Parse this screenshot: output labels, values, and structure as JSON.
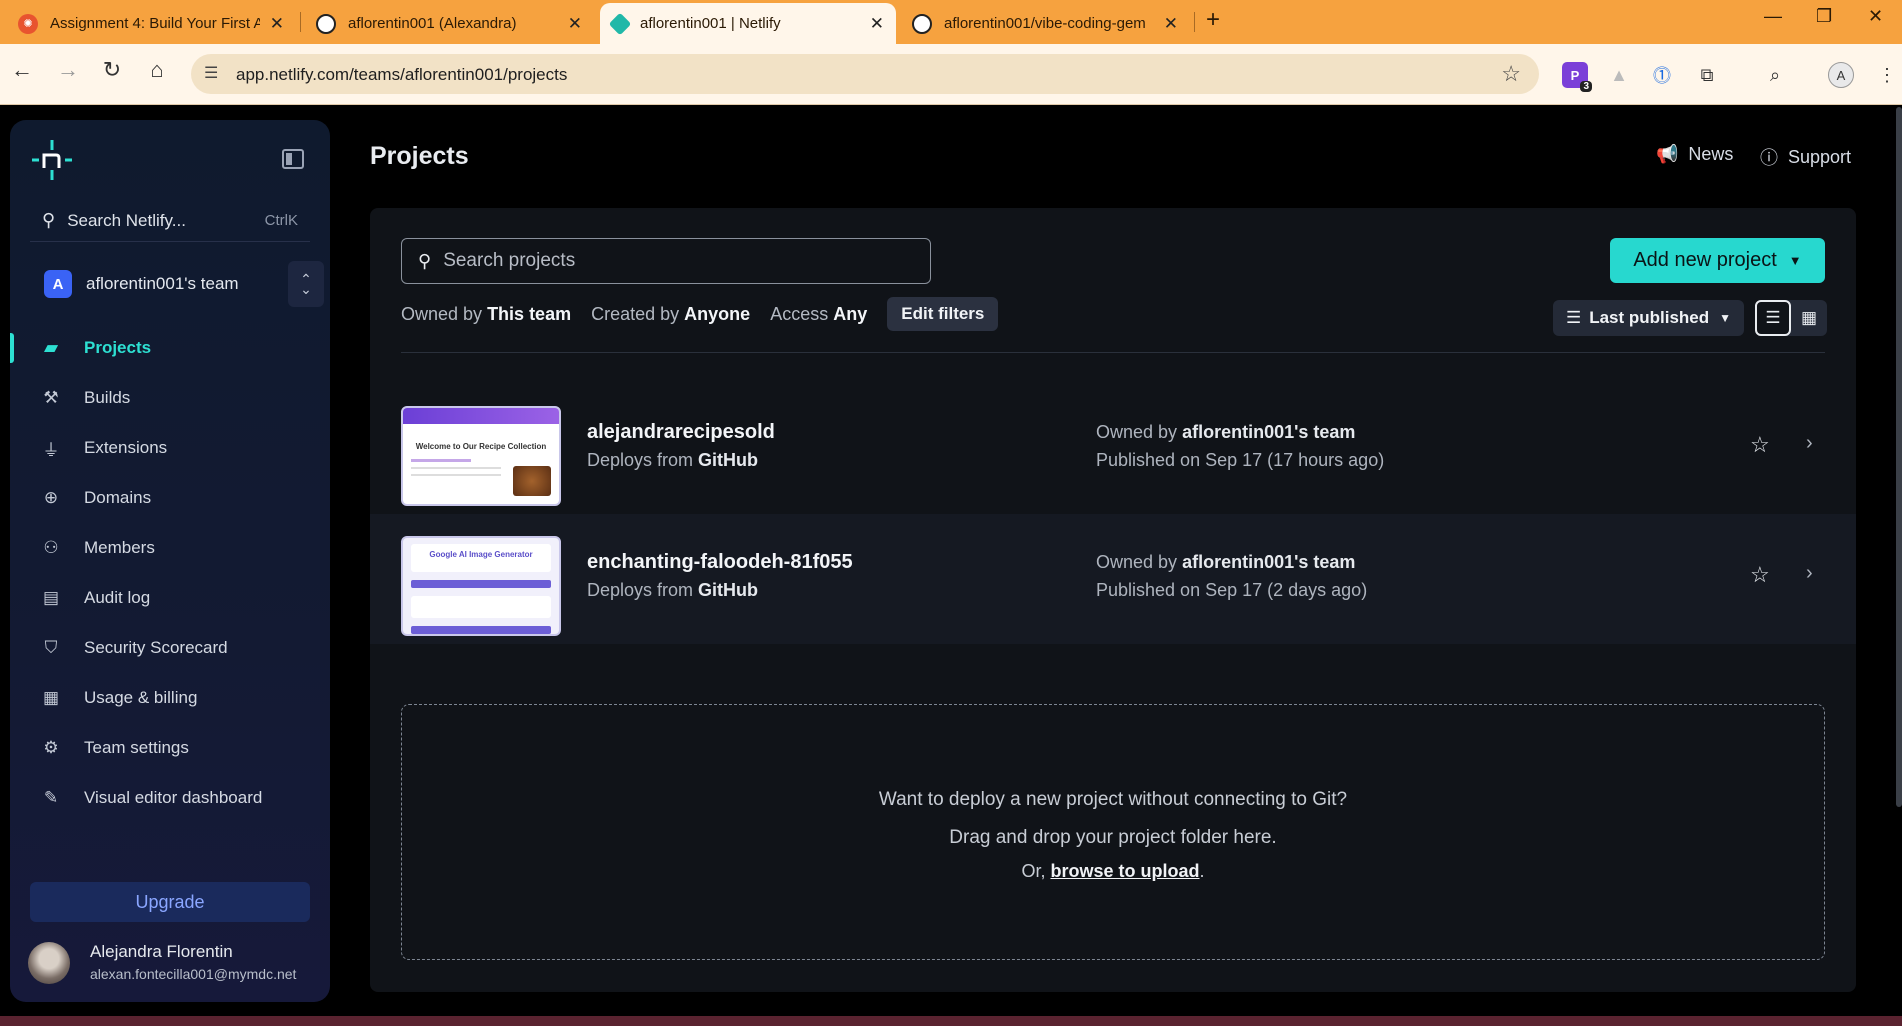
{
  "browser": {
    "tabs": [
      {
        "label": "Assignment 4: Build Your First A",
        "active": false
      },
      {
        "label": "aflorentin001 (Alexandra)",
        "active": false
      },
      {
        "label": "aflorentin001 | Netlify",
        "active": true
      },
      {
        "label": "aflorentin001/vibe-coding-gem",
        "active": false
      }
    ],
    "url": "app.netlify.com/teams/aflorentin001/projects",
    "extension_badge": "3",
    "profile_initial": "A"
  },
  "sidebar": {
    "search_label": "Search Netlify...",
    "search_shortcut": "CtrlK",
    "team_initial": "A",
    "team_name": "aflorentin001's team",
    "items": [
      {
        "label": "Projects",
        "icon": "projects-icon"
      },
      {
        "label": "Builds",
        "icon": "hammer-icon"
      },
      {
        "label": "Extensions",
        "icon": "plug-icon"
      },
      {
        "label": "Domains",
        "icon": "globe-icon"
      },
      {
        "label": "Members",
        "icon": "members-icon"
      },
      {
        "label": "Audit log",
        "icon": "audit-log-icon"
      },
      {
        "label": "Security Scorecard",
        "icon": "shield-icon"
      },
      {
        "label": "Usage & billing",
        "icon": "receipt-icon"
      },
      {
        "label": "Team settings",
        "icon": "gear-icon"
      },
      {
        "label": "Visual editor dashboard",
        "icon": "pencil-icon"
      }
    ],
    "upgrade_label": "Upgrade",
    "user_name": "Alejandra Florentin",
    "user_email": "alexan.fontecilla001@mymdc.net"
  },
  "main": {
    "title": "Projects",
    "news_label": "News",
    "support_label": "Support",
    "search_placeholder": "Search projects",
    "add_button_label": "Add new project",
    "filters": {
      "owned_prefix": "Owned by",
      "owned_value": "This team",
      "created_prefix": "Created by",
      "created_value": "Anyone",
      "access_prefix": "Access",
      "access_value": "Any",
      "edit_label": "Edit filters"
    },
    "sort_label": "Last published",
    "projects": [
      {
        "name": "alejandrarecipesold",
        "deploy_prefix": "Deploys from",
        "deploy_source": "GitHub",
        "owner_prefix": "Owned by",
        "owner": "aflorentin001's team",
        "published": "Published on Sep 17 (17 hours ago)",
        "thumb_title": "Welcome to Our Recipe Collection"
      },
      {
        "name": "enchanting-faloodeh-81f055",
        "deploy_prefix": "Deploys from",
        "deploy_source": "GitHub",
        "owner_prefix": "Owned by",
        "owner": "aflorentin001's team",
        "published": "Published on Sep 17 (2 days ago)",
        "thumb_title": "Google AI Image Generator"
      }
    ],
    "dropzone": {
      "line1": "Want to deploy a new project without connecting to Git?",
      "line2": "Drag and drop your project folder here.",
      "line3_prefix": "Or,",
      "line3_link": "browse to upload",
      "line3_suffix": "."
    }
  },
  "colors": {
    "tabbar": "#f6a23f",
    "accent": "#2de0d2",
    "add_button": "#27d8cf",
    "panel": "#101318"
  }
}
